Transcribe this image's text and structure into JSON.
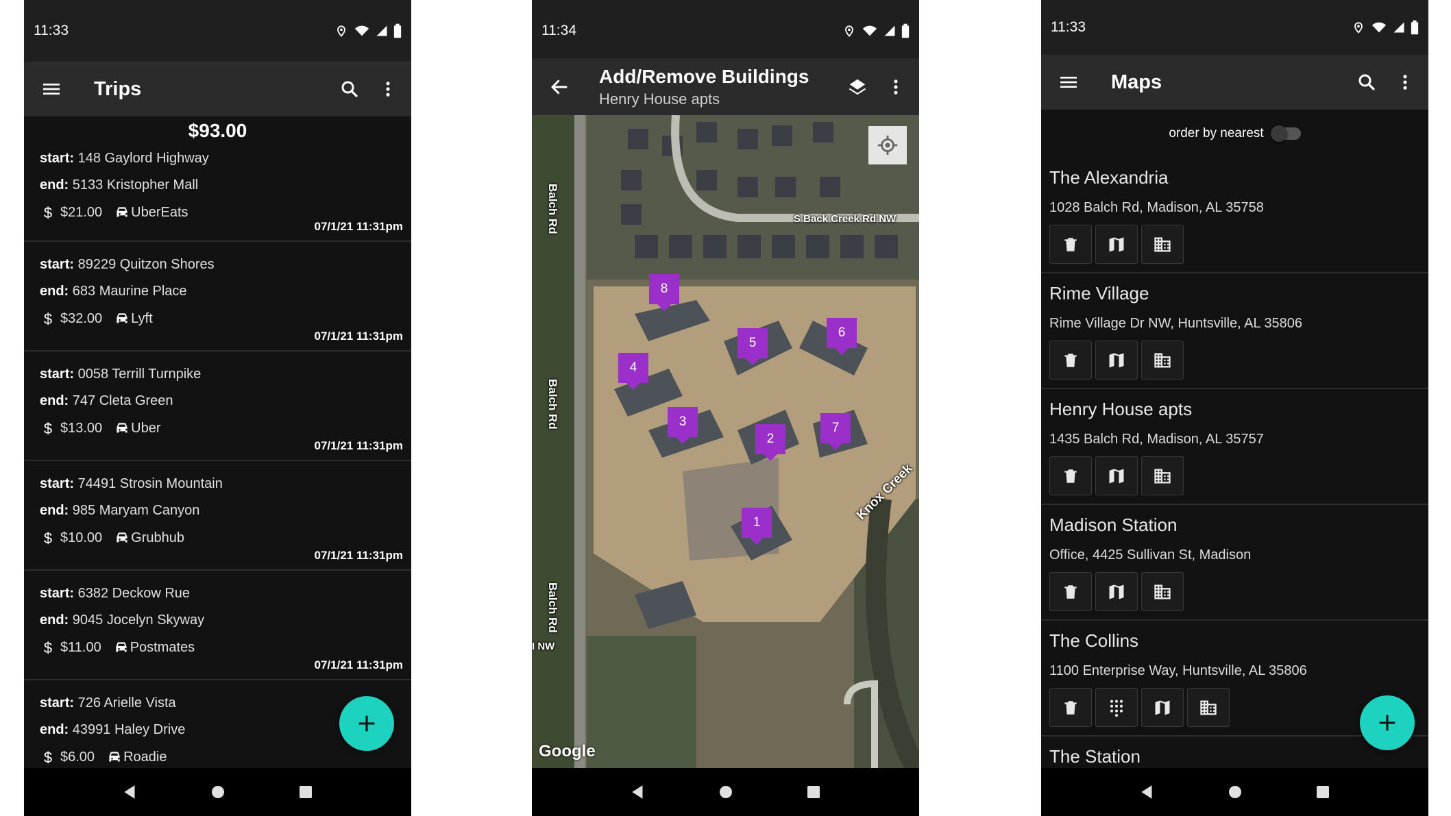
{
  "trips_screen": {
    "status_time": "11:33",
    "title": "Trips",
    "total": "$93.00",
    "start_label": "start:",
    "end_label": "end:",
    "trips": [
      {
        "start": "148 Gaylord Highway",
        "end": "5133 Kristopher Mall",
        "amount": "$21.00",
        "service": "UberEats",
        "date": "07/1/21 11:31pm"
      },
      {
        "start": "89229 Quitzon Shores",
        "end": "683 Maurine Place",
        "amount": "$32.00",
        "service": "Lyft",
        "date": "07/1/21 11:31pm"
      },
      {
        "start": "0058 Terrill Turnpike",
        "end": "747 Cleta Green",
        "amount": "$13.00",
        "service": "Uber",
        "date": "07/1/21 11:31pm"
      },
      {
        "start": "74491 Strosin Mountain",
        "end": "985 Maryam Canyon",
        "amount": "$10.00",
        "service": "Grubhub",
        "date": "07/1/21 11:31pm"
      },
      {
        "start": "6382 Deckow Rue",
        "end": "9045 Jocelyn Skyway",
        "amount": "$11.00",
        "service": "Postmates",
        "date": "07/1/21 11:31pm"
      },
      {
        "start": "726 Arielle Vista",
        "end": "43991 Haley Drive",
        "amount": "$6.00",
        "service": "Roadie",
        "date": ""
      }
    ],
    "fab_label": "+"
  },
  "buildings_screen": {
    "status_time": "11:34",
    "title": "Add/Remove Buildings",
    "subtitle": "Henry House apts",
    "road_labels": [
      "Balch Rd",
      "Balch Rd",
      "Balch Rd",
      "S Back Creek Rd NW",
      "Knox Creek",
      "I NW"
    ],
    "markers": [
      "1",
      "2",
      "3",
      "4",
      "5",
      "6",
      "7",
      "8"
    ],
    "map_attribution": "Google"
  },
  "maps_screen": {
    "status_time": "11:33",
    "title": "Maps",
    "order_label": "order by nearest",
    "order_by_nearest": false,
    "items": [
      {
        "name": "The Alexandria",
        "address": "1028 Balch Rd, Madison, AL 35758"
      },
      {
        "name": "Rime Village",
        "address": "Rime Village Dr NW, Huntsville, AL 35806"
      },
      {
        "name": "Henry House apts",
        "address": "1435 Balch Rd, Madison, AL 35757"
      },
      {
        "name": "Madison Station",
        "address": "Office, 4425 Sullivan St, Madison"
      },
      {
        "name": "The Collins",
        "address": "1100 Enterprise Way, Huntsville, AL 35806"
      },
      {
        "name": "The Station",
        "address": ""
      }
    ],
    "fab_label": "+"
  },
  "colors": {
    "background": "#121212",
    "appbar": "#2b2b2b",
    "accent_fab": "#1dd3c0",
    "marker": "#9b2fc9"
  }
}
